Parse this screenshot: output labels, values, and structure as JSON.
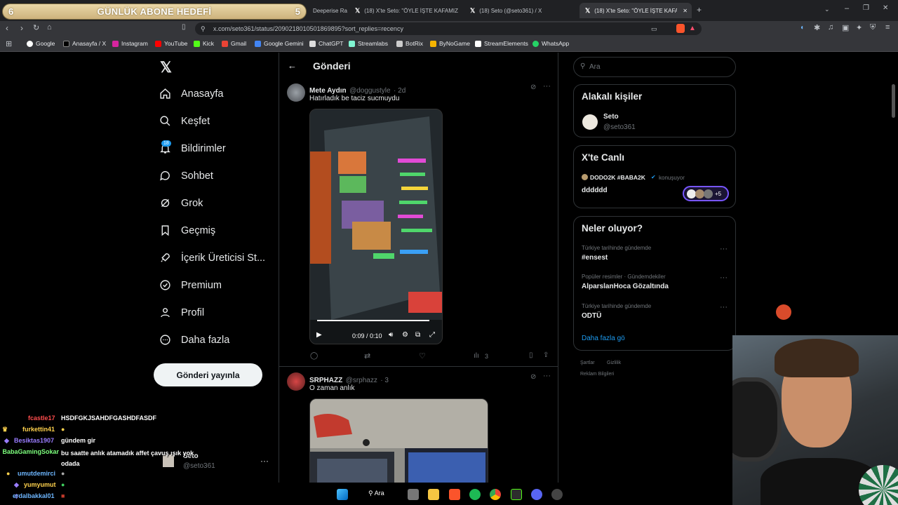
{
  "goal": {
    "left": "6",
    "title": "GÜNLÜK ABONE HEDEFİ",
    "right": "5"
  },
  "tabs": [
    {
      "label": "Deeperise Ra"
    },
    {
      "label": "(18) X'te Seto: \"ÖYLE İŞTE KAFAMIZ"
    },
    {
      "label": "(18) Seto (@seto361) / X"
    },
    {
      "label": "(18) X'te Seto: \"ÖYLE İŞTE KAFAM"
    }
  ],
  "address": {
    "url": "x.com/seto361/status/2090218010501869895?sort_replies=recency"
  },
  "bookmarks": [
    "Google",
    "Anasayfa / X",
    "Instagram",
    "YouTube",
    "Kick",
    "Gmail",
    "Google Gemini",
    "ChatGPT",
    "Streamlabs",
    "BotRix",
    "ByNoGame",
    "StreamElements",
    "WhatsApp"
  ],
  "nav": {
    "home": "Anasayfa",
    "explore": "Keşfet",
    "notifications": "Bildirimler",
    "notif_count": "18",
    "chat": "Sohbet",
    "grok": "Grok",
    "history": "Geçmiş",
    "creator": "İçerik Üreticisi St...",
    "premium": "Premium",
    "profile": "Profil",
    "more": "Daha fazla",
    "post": "Gönderi yayınla"
  },
  "account": {
    "name": "Seto",
    "handle": "@seto361"
  },
  "center": {
    "header": "Gönderi"
  },
  "tweet1": {
    "name": "Mete Aydın",
    "handle": "@doggustyle",
    "time": "· 2d",
    "text": "Hatırladık be taciz sucmuydu",
    "video_time": "0:09 / 0:10",
    "views": "3"
  },
  "tweet2": {
    "name": "SRPHAZZ",
    "handle": "@srphazz",
    "time": "· 3",
    "text": "O zaman anlık"
  },
  "search": {
    "placeholder": "Ara"
  },
  "related": {
    "title": "Alakalı kişiler",
    "name": "Seto",
    "handle": "@seto361"
  },
  "live": {
    "title": "X'te Canlı",
    "host": "DODO2K #BABA2K",
    "status": "konuşuyor",
    "room": "dddddd",
    "extra": "+5"
  },
  "trends": {
    "title": "Neler oluyor?",
    "items": [
      {
        "meta": "Türkiye tarihinde gündemde",
        "name": "#ensest"
      },
      {
        "meta": "Popüler resimler · Gündemdekiler",
        "name": "AlparslanHoca Gözaltında"
      },
      {
        "meta": "Türkiye tarihinde gündemde",
        "name": "ODTÜ"
      }
    ],
    "more": "Daha fazla gö"
  },
  "footer": {
    "terms": "Şartlar",
    "privacy": "Gizlilik",
    "ads": "Reklam Bilgileri"
  },
  "chat": [
    {
      "user": "fcastle17",
      "msg": "HSDFGKJSAHDFGASHDFASDF",
      "color": "#ff4d4d"
    },
    {
      "user": "furkettin41",
      "msg": "",
      "color": "#ffd24d"
    },
    {
      "user": "Besiktas1907",
      "msg": "gündem gir",
      "color": "#9a7dff"
    },
    {
      "user": "BabaGamingSokar",
      "msg": "bu saatte anlık atamadık affet çavuş ışık yok odada",
      "color": "#7dff7d"
    },
    {
      "user": "umutdemirci",
      "msg": "",
      "color": "#6db6ff"
    },
    {
      "user": "yumyumut",
      "msg": "",
      "color": "#ffd24d"
    },
    {
      "user": "erdalbakkal01",
      "msg": "",
      "color": "#6db6ff"
    }
  ],
  "taskbar": {
    "search": "Ara"
  }
}
